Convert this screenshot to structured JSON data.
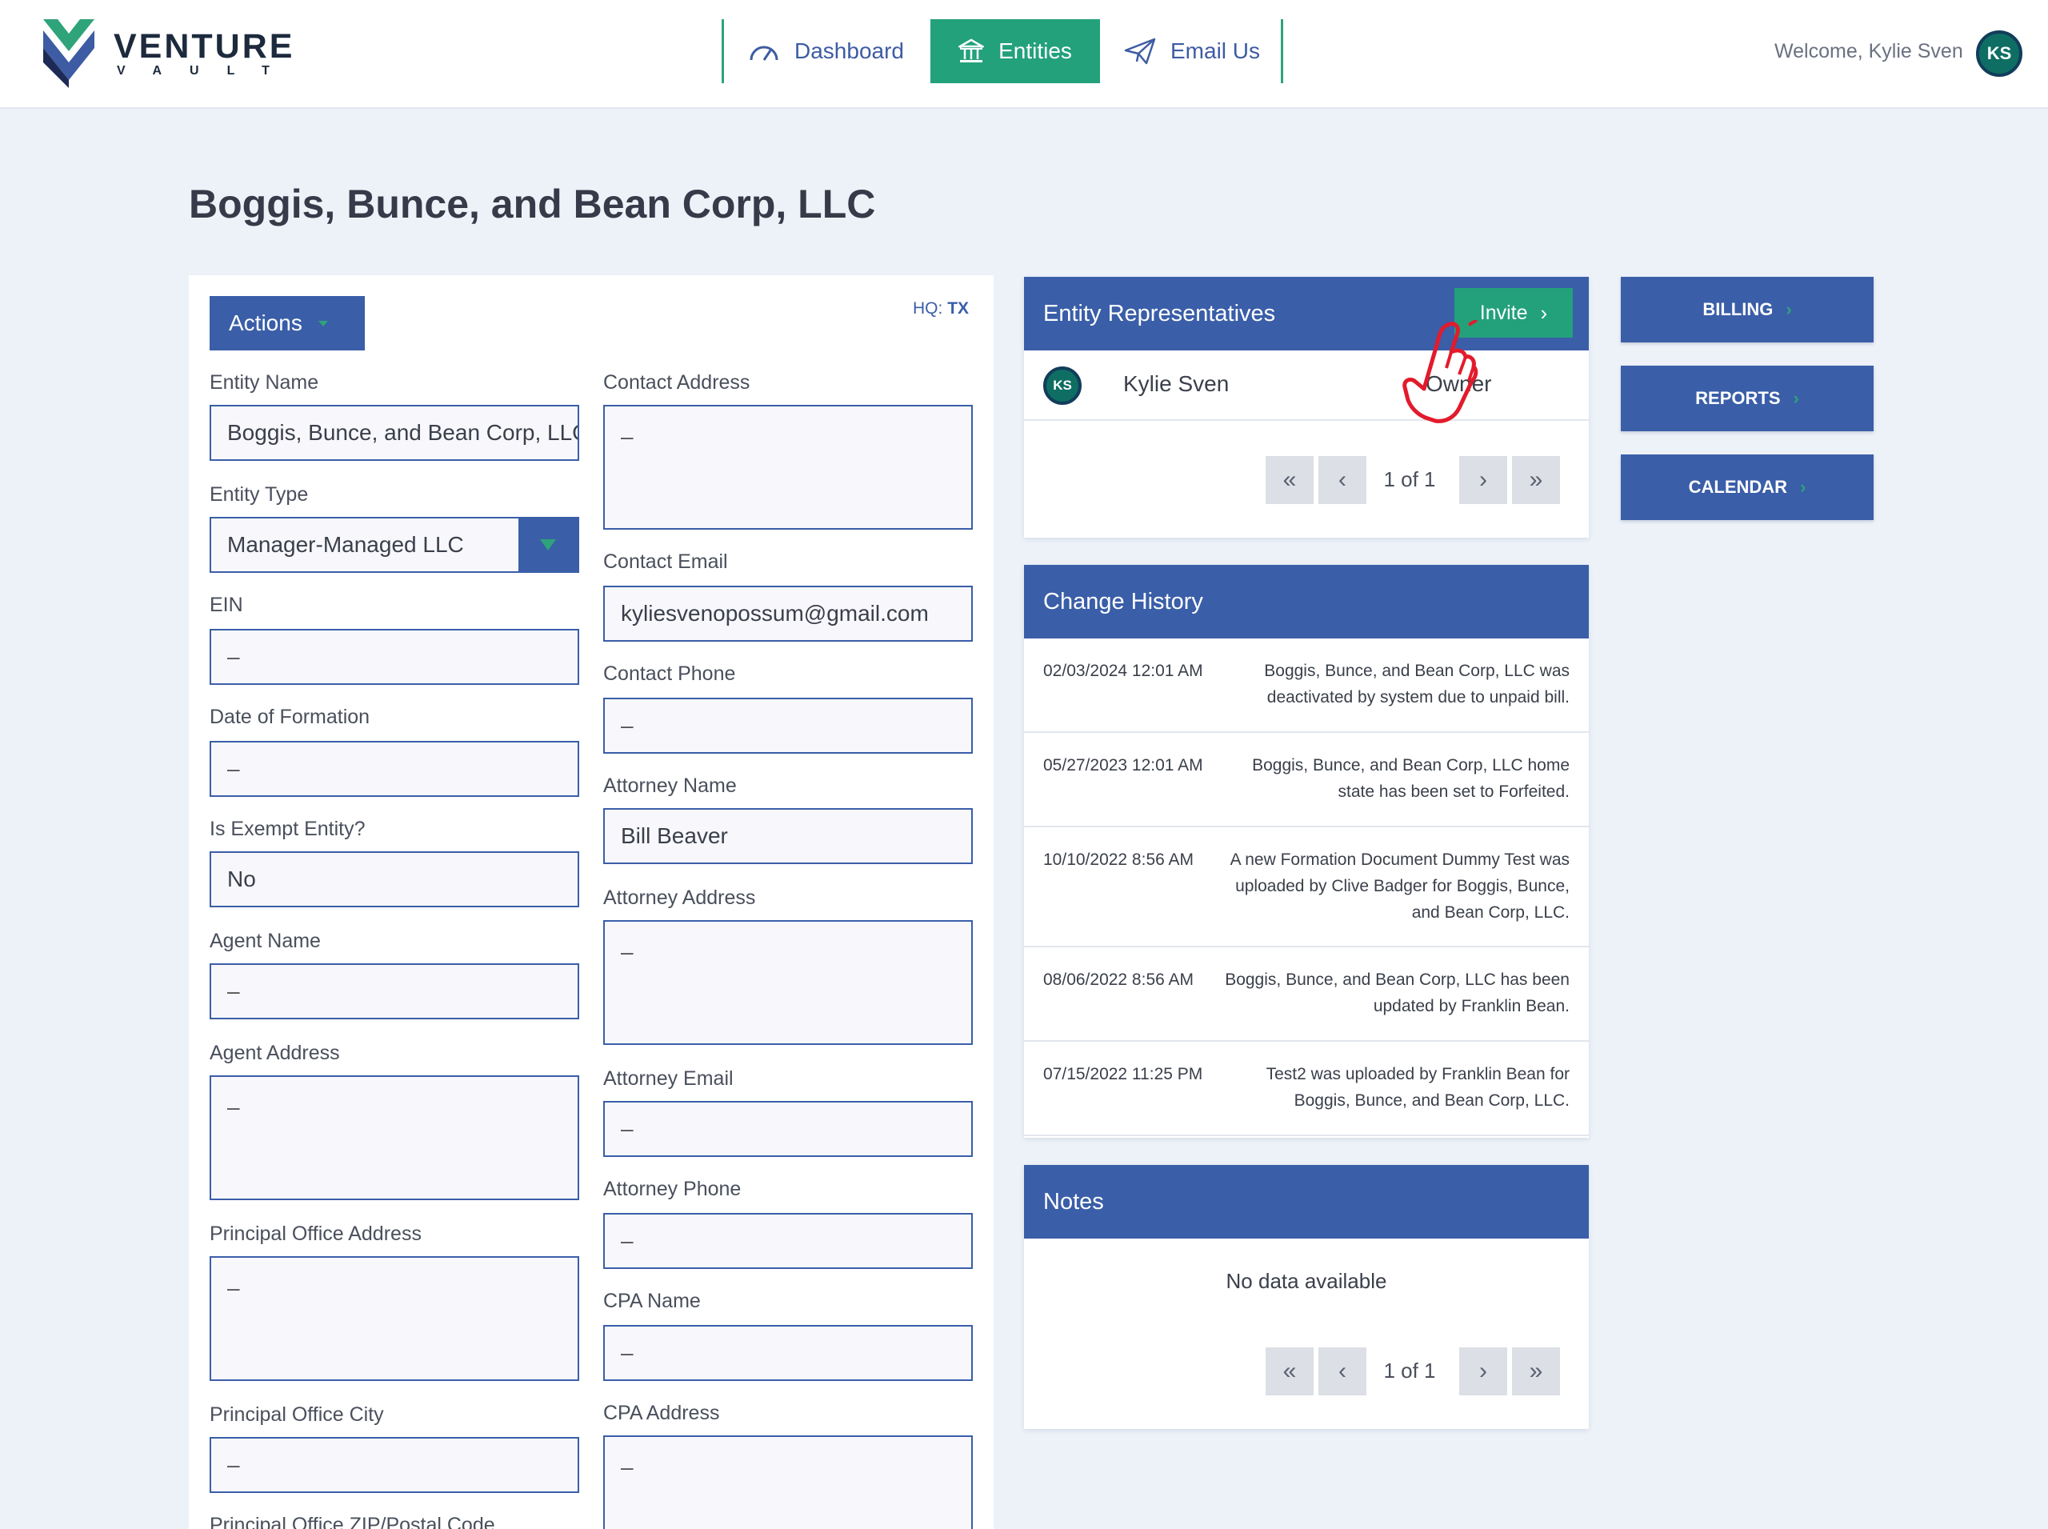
{
  "header": {
    "logo_word": "VENTURE",
    "logo_sub": "VAULT",
    "nav": {
      "dashboard": "Dashboard",
      "entities": "Entities",
      "email": "Email Us"
    },
    "welcome": "Welcome, Kylie Sven",
    "avatar_initials": "KS"
  },
  "page_title": "Boggis, Bunce, and Bean Corp, LLC",
  "form": {
    "actions_label": "Actions",
    "hq_label": "HQ:",
    "hq_value": "TX",
    "left": [
      {
        "label": "Entity Name",
        "value": "Boggis, Bunce, and Bean Corp, LLC"
      },
      {
        "label": "Entity Type",
        "value": "Manager-Managed LLC"
      },
      {
        "label": "EIN",
        "value": "–"
      },
      {
        "label": "Date of Formation",
        "value": "–"
      },
      {
        "label": "Is Exempt Entity?",
        "value": "No"
      },
      {
        "label": "Agent Name",
        "value": "–"
      },
      {
        "label": "Agent Address",
        "value": "–"
      },
      {
        "label": "Principal Office Address",
        "value": "–"
      },
      {
        "label": "Principal Office City",
        "value": "–"
      },
      {
        "label": "Principal Office ZIP/Postal Code",
        "value": ""
      }
    ],
    "right": [
      {
        "label": "Contact Address",
        "value": "–"
      },
      {
        "label": "Contact Email",
        "value": "kyliesvenopossum@gmail.com"
      },
      {
        "label": "Contact Phone",
        "value": "–"
      },
      {
        "label": "Attorney Name",
        "value": "Bill Beaver"
      },
      {
        "label": "Attorney Address",
        "value": "–"
      },
      {
        "label": "Attorney Email",
        "value": "–"
      },
      {
        "label": "Attorney Phone",
        "value": "–"
      },
      {
        "label": "CPA Name",
        "value": "–"
      },
      {
        "label": "CPA Address",
        "value": "–"
      }
    ]
  },
  "representatives": {
    "title": "Entity Representatives",
    "invite_label": "Invite",
    "rows": [
      {
        "initials": "KS",
        "name": "Kylie Sven",
        "role": "Owner"
      }
    ],
    "pager_text": "1 of 1"
  },
  "history": {
    "title": "Change History",
    "rows": [
      {
        "date": "02/03/2024 12:01 AM",
        "text": "Boggis, Bunce, and Bean Corp, LLC was deactivated by system due to unpaid bill."
      },
      {
        "date": "05/27/2023 12:01 AM",
        "text": "Boggis, Bunce, and Bean Corp, LLC home state has been set to Forfeited."
      },
      {
        "date": "10/10/2022 8:56 AM",
        "text": "A new Formation Document Dummy Test was uploaded by Clive Badger for Boggis, Bunce, and Bean Corp, LLC."
      },
      {
        "date": "08/06/2022 8:56 AM",
        "text": "Boggis, Bunce, and Bean Corp, LLC has been updated by Franklin Bean."
      },
      {
        "date": "07/15/2022 11:25 PM",
        "text": "Test2 was uploaded by Franklin Bean for Boggis, Bunce, and Bean Corp, LLC."
      }
    ]
  },
  "notes": {
    "title": "Notes",
    "empty_text": "No data available",
    "pager_text": "1 of 1"
  },
  "side_buttons": {
    "billing": "BILLING",
    "reports": "REPORTS",
    "calendar": "CALENDAR"
  },
  "colors": {
    "primary": "#3a5ea8",
    "accent": "#23a17b",
    "background": "#edf2f9"
  }
}
